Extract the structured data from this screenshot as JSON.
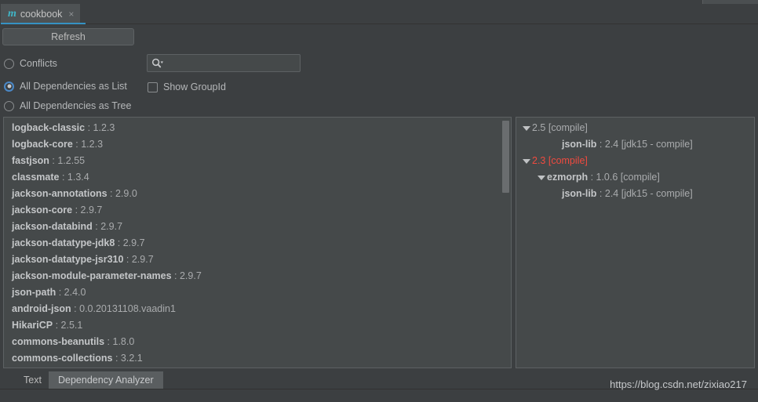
{
  "window": {
    "tab": {
      "icon": "maven-m-icon",
      "label": "cookbook",
      "close": "×"
    }
  },
  "toolbar": {
    "refresh_label": "Refresh"
  },
  "options": {
    "radios": [
      {
        "label": "Conflicts",
        "selected": false
      },
      {
        "label": "All Dependencies as List",
        "selected": true
      },
      {
        "label": "All Dependencies as Tree",
        "selected": false
      }
    ],
    "checkbox": {
      "label": "Show GroupId",
      "checked": false
    }
  },
  "search": {
    "icon": "search-icon",
    "value": "",
    "placeholder": ""
  },
  "dependencies": [
    {
      "name": "logback-classic",
      "sep": " : ",
      "version": "1.2.3"
    },
    {
      "name": "logback-core",
      "sep": " : ",
      "version": "1.2.3"
    },
    {
      "name": "fastjson",
      "sep": " : ",
      "version": "1.2.55"
    },
    {
      "name": "classmate",
      "sep": " : ",
      "version": "1.3.4"
    },
    {
      "name": "jackson-annotations",
      "sep": " : ",
      "version": "2.9.0"
    },
    {
      "name": "jackson-core",
      "sep": " : ",
      "version": "2.9.7"
    },
    {
      "name": "jackson-databind",
      "sep": " : ",
      "version": "2.9.7"
    },
    {
      "name": "jackson-datatype-jdk8",
      "sep": " : ",
      "version": "2.9.7"
    },
    {
      "name": "jackson-datatype-jsr310",
      "sep": " : ",
      "version": "2.9.7"
    },
    {
      "name": "jackson-module-parameter-names",
      "sep": " : ",
      "version": "2.9.7"
    },
    {
      "name": "json-path",
      "sep": " : ",
      "version": "2.4.0"
    },
    {
      "name": "android-json",
      "sep": " : ",
      "version": "0.0.20131108.vaadin1"
    },
    {
      "name": "HikariCP",
      "sep": " : ",
      "version": "2.5.1"
    },
    {
      "name": "commons-beanutils",
      "sep": " : ",
      "version": "1.8.0"
    },
    {
      "name": "commons-collections",
      "sep": " : ",
      "version": "3.2.1"
    }
  ],
  "tree": [
    {
      "indent": 0,
      "expander": true,
      "bold": "",
      "rest": "2.5 [compile]",
      "conflict": false
    },
    {
      "indent": 2,
      "expander": false,
      "bold": "json-lib",
      "rest": " : 2.4 [jdk15 - compile]",
      "conflict": false
    },
    {
      "indent": 0,
      "expander": true,
      "bold": "",
      "rest": "2.3 [compile]",
      "conflict": true
    },
    {
      "indent": 1,
      "expander": true,
      "bold": "ezmorph",
      "rest": " : 1.0.6 [compile]",
      "conflict": false
    },
    {
      "indent": 2,
      "expander": false,
      "bold": "json-lib",
      "rest": " : 2.4 [jdk15 - compile]",
      "conflict": false
    }
  ],
  "bottom_tabs": [
    {
      "label": "Text",
      "active": false
    },
    {
      "label": "Dependency Analyzer",
      "active": true
    }
  ],
  "watermark": "https://blog.csdn.net/zixiao217",
  "colors": {
    "background": "#3c3f41",
    "panel": "#45494a",
    "accent": "#3592c4",
    "tab_icon": "#40b6c8",
    "conflict": "#f04a3f",
    "text": "#bbbbbb"
  }
}
